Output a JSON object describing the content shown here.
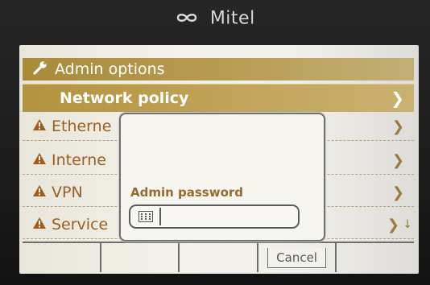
{
  "brand": {
    "name": "Mitel",
    "logo_icon": "mitel-infinity-logo"
  },
  "menu": {
    "title": "Admin options",
    "selected": {
      "label": "Network policy"
    },
    "items": [
      {
        "label": "Etherne"
      },
      {
        "label": "Interne"
      },
      {
        "label": "VPN"
      },
      {
        "label": "Service"
      }
    ]
  },
  "dialog": {
    "prompt": "Admin password",
    "input_value": "",
    "icon": "keypad-icon"
  },
  "softkeys": [
    "",
    "",
    "",
    "Cancel",
    ""
  ],
  "colors": {
    "accent": "#b2933f",
    "warning": "#9c5d1f"
  }
}
